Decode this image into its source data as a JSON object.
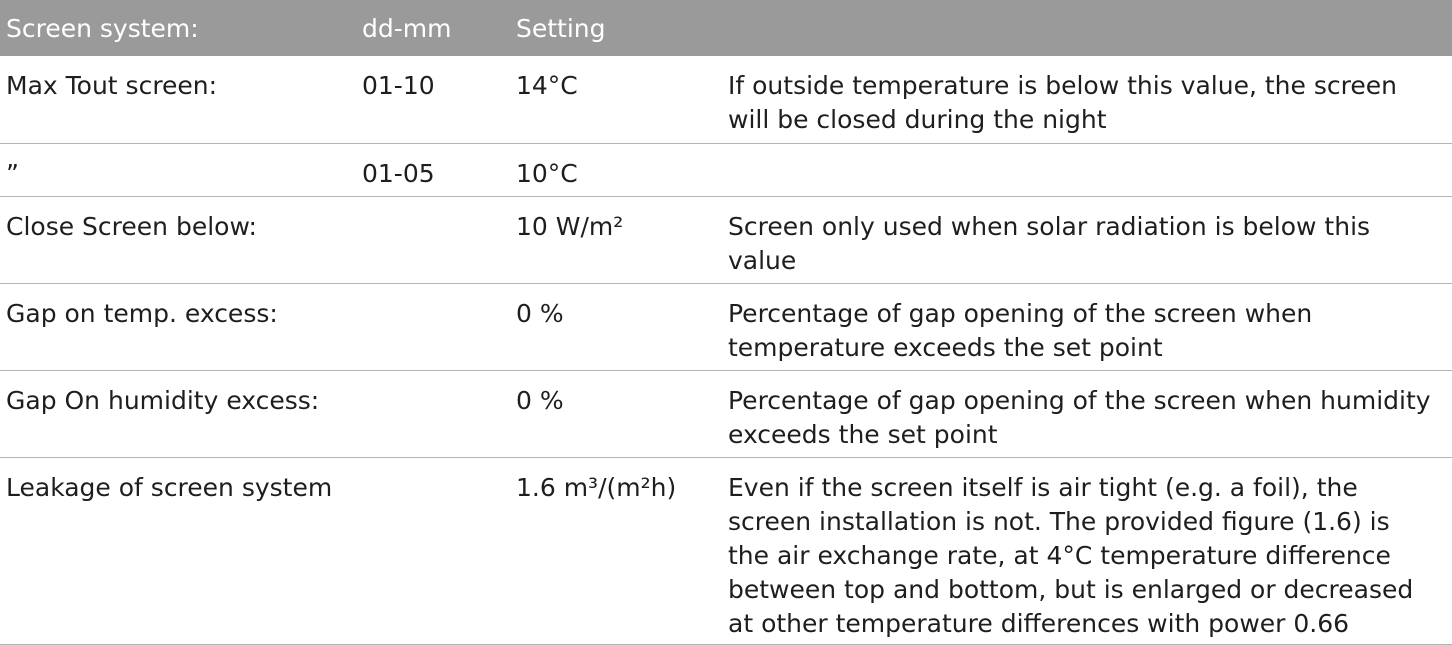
{
  "header": {
    "col1": "Screen system:",
    "col2": "dd-mm",
    "col3": "Setting",
    "col4": ""
  },
  "rows": [
    {
      "name": "Max Tout screen:",
      "date": "01-10",
      "setting": "14°C",
      "description": [
        "If outside temperature is below this value, the screen",
        "will be closed during the night"
      ]
    },
    {
      "name": "”",
      "date": "01-05",
      "setting": "10°C",
      "description": []
    },
    {
      "name": "Close Screen below:",
      "date": "",
      "setting": "10 W/m²",
      "description": [
        "Screen only used when solar radiation is below this",
        "value"
      ]
    },
    {
      "name": "Gap on temp. excess:",
      "date": "",
      "setting": "0 %",
      "description": [
        "Percentage of gap opening of the screen when",
        "temperature exceeds the set point"
      ]
    },
    {
      "name": "Gap On humidity excess:",
      "date": "",
      "setting": "0 %",
      "description": [
        "Percentage of gap opening of the screen when humidity",
        "exceeds the set point"
      ]
    },
    {
      "name": "Leakage of screen system",
      "date": "",
      "setting": "1.6 m³/(m²h)",
      "description": [
        "Even if the screen itself is air tight (e.g. a foil), the",
        "screen installation is not. The provided figure (1.6) is",
        "the air exchange rate, at 4°C temperature difference",
        "between top and bottom, but is enlarged or decreased",
        "at other temperature differences with power 0.66"
      ]
    }
  ]
}
